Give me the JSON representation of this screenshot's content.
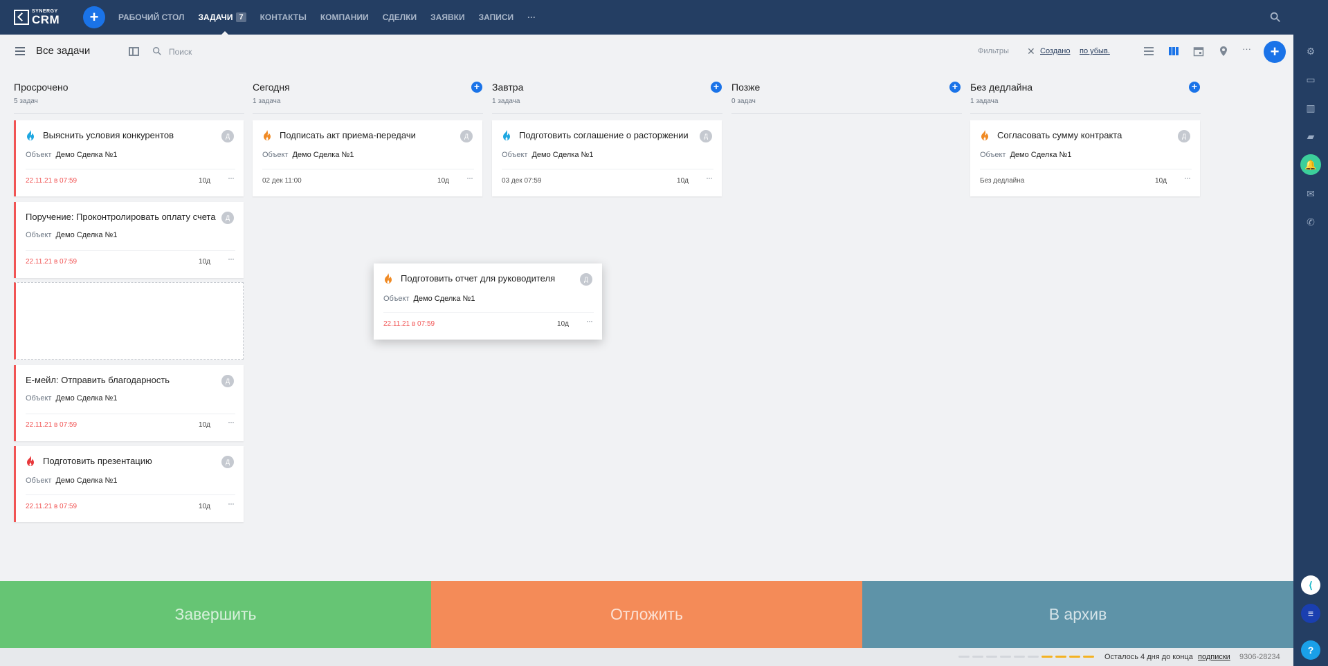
{
  "brand": {
    "small": "SYNERGY",
    "big": "CRM"
  },
  "nav": [
    {
      "label": "РАБОЧИЙ СТОЛ"
    },
    {
      "label": "ЗАДАЧИ",
      "badge": "7"
    },
    {
      "label": "КОНТАКТЫ"
    },
    {
      "label": "КОМПАНИИ"
    },
    {
      "label": "СДЕЛКИ"
    },
    {
      "label": "ЗАЯВКИ"
    },
    {
      "label": "ЗАПИСИ"
    },
    {
      "label": "···"
    }
  ],
  "user_initial": "Д",
  "toolbar": {
    "title": "Все задачи",
    "search_placeholder": "Поиск",
    "filters_label": "Фильтры",
    "sort_field": "Создано",
    "sort_direction": "по убыв.",
    "more": "···"
  },
  "columns": [
    {
      "title": "Просрочено",
      "count": "5 задач"
    },
    {
      "title": "Сегодня",
      "count": "1 задача"
    },
    {
      "title": "Завтра",
      "count": "1 задача"
    },
    {
      "title": "Позже",
      "count": "0 задач"
    },
    {
      "title": "Без дедлайна",
      "count": "1 задача"
    }
  ],
  "object_label": "Объект",
  "object_value": "Демо Сделка №1",
  "cards": [
    {
      "title": "Выяснить условия конкурентов",
      "date": "22.11.21 в 07:59",
      "days": "10д",
      "priority_icon": "fire-blue"
    },
    {
      "title": "Поручение: Проконтролировать оплату счета",
      "date": "22.11.21 в 07:59",
      "days": "10д"
    },
    {
      "title": "Е-мейл: Отправить благодарность",
      "date": "22.11.21 в 07:59",
      "days": "10д"
    },
    {
      "title": "Подготовить презентацию",
      "date": "22.11.21 в 07:59",
      "days": "10д",
      "priority_icon": "fire-red"
    },
    {
      "title": "Подписать акт приема-передачи",
      "date": "02 дек 11:00",
      "days": "10д",
      "priority_icon": "fire-orange"
    },
    {
      "title": "Подготовить соглашение о расторжении",
      "date": "03 дек 07:59",
      "days": "10д",
      "priority_icon": "fire-blue"
    },
    {
      "title": "Согласовать сумму контракта",
      "date": "Без дедлайна",
      "days": "10д",
      "priority_icon": "fire-orange"
    },
    {
      "title": "Подготовить отчет для руководителя",
      "date": "22.11.21 в 07:59",
      "days": "10д",
      "priority_icon": "fire-orange"
    }
  ],
  "card_initial": "Д",
  "card_menu": "···",
  "zones": [
    {
      "label": "Завершить",
      "color": "#66c574"
    },
    {
      "label": "Отложить",
      "color": "#f48b58"
    },
    {
      "label": "В архив",
      "color": "#5e93a8"
    }
  ],
  "status": {
    "text": "Осталось 4 дня до конца",
    "link": "подписки",
    "code": "9306-28234",
    "progress_segments_total": 10,
    "progress_segments_remaining": 4
  },
  "colors": {
    "topbar": "#243e63",
    "accent": "#1a73e8",
    "overdue": "#f15454",
    "notification": "#3ccf9b",
    "progress_done": "#f4b223",
    "progress_empty": "#d3d6db"
  }
}
